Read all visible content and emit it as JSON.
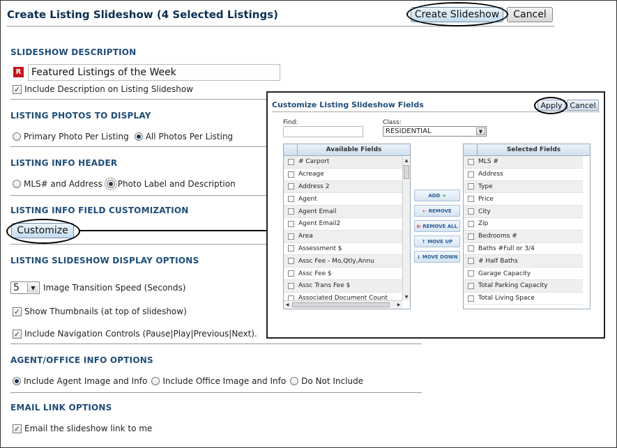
{
  "header": {
    "title": "Create Listing Slideshow (4 Selected Listings)",
    "create_label": "Create Slideshow",
    "cancel_label": "Cancel"
  },
  "slideshow_description": {
    "title": "SLIDESHOW DESCRIPTION",
    "required_icon": "R",
    "value": "Featured Listings of the Week",
    "include_label": "Include Description on Listing Slideshow",
    "include_checked": true
  },
  "listing_photos": {
    "title": "LISTING PHOTOS TO DISPLAY",
    "options": [
      "Primary Photo Per Listing",
      "All Photos Per Listing"
    ],
    "selected": "All Photos Per Listing"
  },
  "listing_info_header": {
    "title": "LISTING INFO HEADER",
    "options": [
      "MLS# and Address",
      "Photo Label and Description"
    ],
    "selected": "Photo Label and Description"
  },
  "field_customization": {
    "title": "LISTING INFO FIELD CUSTOMIZATION",
    "customize_label": "Customize"
  },
  "display_options": {
    "title": "LISTING SLIDESHOW DISPLAY OPTIONS",
    "speed_value": "5",
    "speed_label": "Image Transition Speed (Seconds)",
    "thumbnails_label": "Show Thumbnails (at top of slideshow)",
    "navigation_label": "Include Navigation Controls (Pause|Play|Previous|Next)."
  },
  "agent_office": {
    "title": "AGENT/OFFICE INFO OPTIONS",
    "options": [
      "Include Agent Image and Info",
      "Include Office Image and Info",
      "Do Not Include"
    ],
    "selected": "Include Agent Image and Info"
  },
  "email_link": {
    "title": "EMAIL LINK OPTIONS",
    "label": "Email the slideshow link to me"
  },
  "popup": {
    "title": "Customize Listing Slideshow Fields",
    "apply_label": "Apply",
    "cancel_label": "Cancel",
    "find_label": "Find:",
    "class_label": "Class:",
    "class_value": "RESIDENTIAL",
    "available_header": "Available Fields",
    "selected_header": "Selected Fields",
    "available_fields": [
      "# Carport",
      "Acreage",
      "Address 2",
      "Agent",
      "Agent Email",
      "Agent Email2",
      "Area",
      "Assessment $",
      "Assc Fee - Mo,Qtly,Annu",
      "Assc Fee $",
      "Assc Trans Fee $",
      "Associated Document Count"
    ],
    "selected_fields": [
      "MLS #",
      "Address",
      "Type",
      "Price",
      "City",
      "Zip",
      "Bedrooms #",
      "Baths #Full or 3/4",
      "# Half Baths",
      "Garage Capacity",
      "Total Parking Capacity",
      "Total Living Space"
    ],
    "move_buttons": {
      "add": "ADD",
      "remove": "REMOVE",
      "remove_all": "REMOVE ALL",
      "move_up": "MOVE UP",
      "move_down": "MOVE DOWN"
    }
  }
}
